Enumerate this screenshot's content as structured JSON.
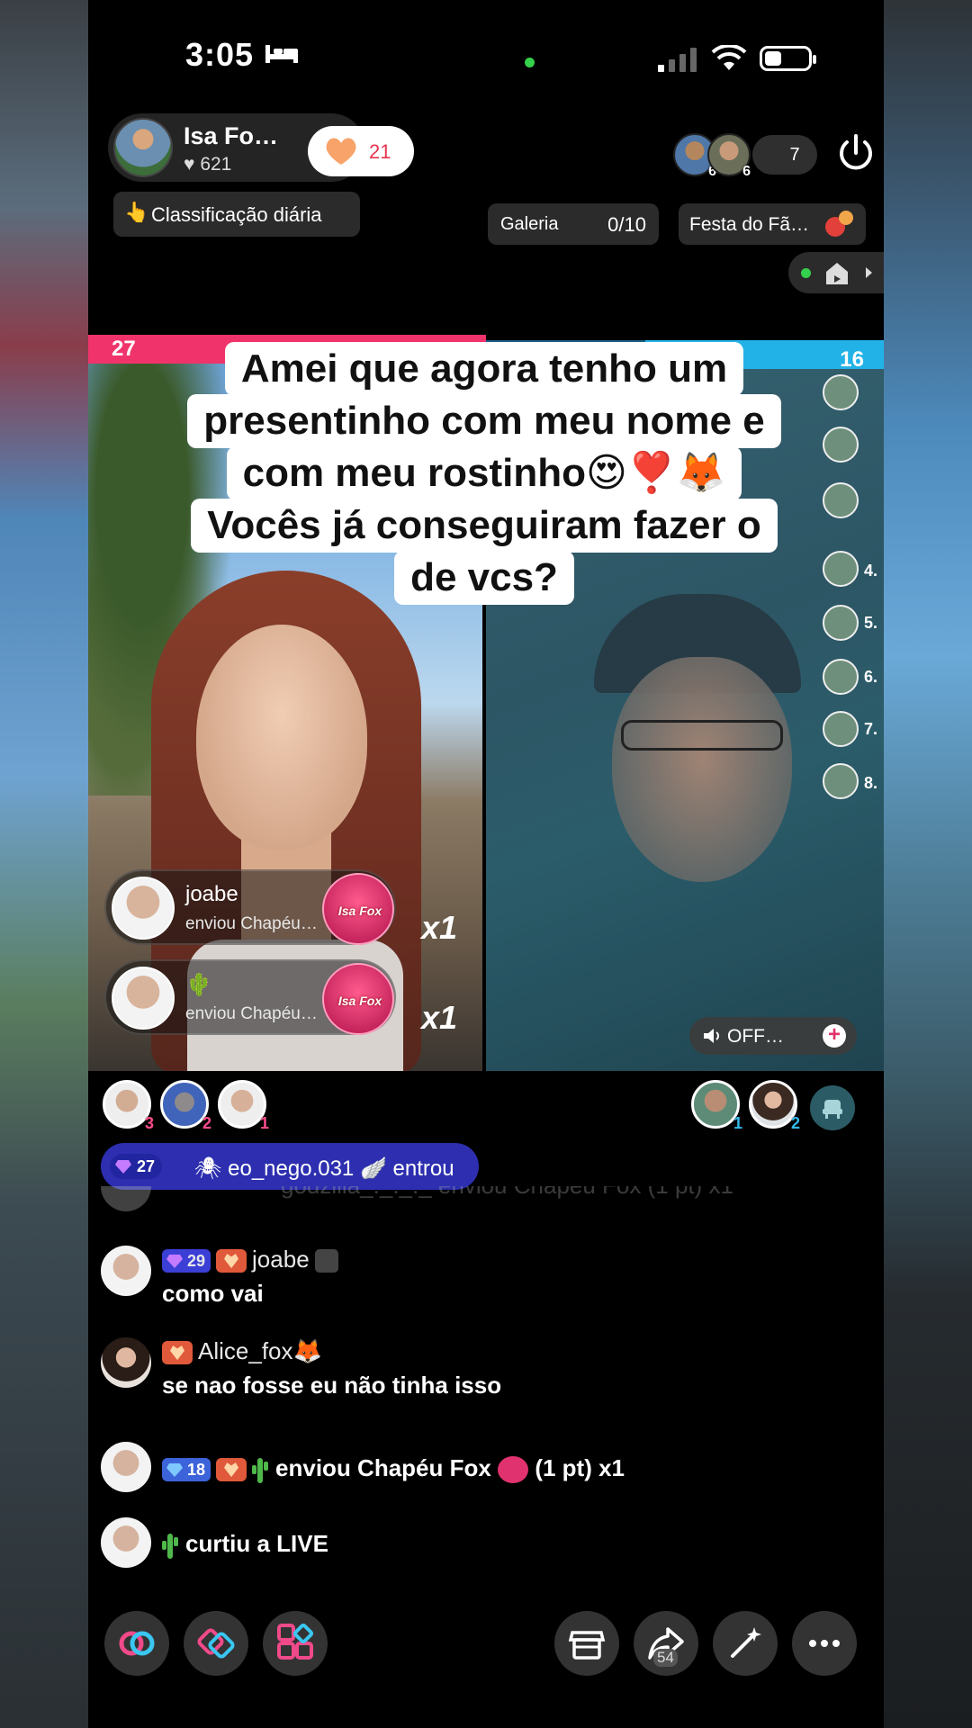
{
  "status_bar": {
    "time": "3:05"
  },
  "host": {
    "name": "Isa Fo…",
    "likes": "621",
    "like_button_count": "21"
  },
  "ranking": {
    "label": "Classificação diária"
  },
  "viewers": {
    "avatar1_badge": "6",
    "avatar2_badge": "6",
    "count": "7"
  },
  "galeria": {
    "label": "Galeria",
    "value": "0/10"
  },
  "festa": {
    "label": "Festa do Fã…"
  },
  "battle": {
    "score_left": "27",
    "score_right": "16",
    "ranks": [
      "4.",
      "5.",
      "6.",
      "7.",
      "8."
    ]
  },
  "caption": {
    "lines": [
      "Amei que agora tenho um",
      "presentinho com meu nome e",
      "com meu rostinho😍❣️🦊",
      "Vocês já conseguiram fazer o",
      "de vcs?"
    ]
  },
  "gifts": [
    {
      "name": "joabe",
      "text": "enviou Chapéu…",
      "badge": "Isa Fox",
      "multiplier": "x1"
    },
    {
      "name": "🌵",
      "text": "enviou Chapéu…",
      "badge": "Isa Fox",
      "multiplier": "x1"
    }
  ],
  "audio_pill": {
    "label": "OFF…"
  },
  "top_gifters": {
    "ranks": [
      "3",
      "2",
      "1"
    ]
  },
  "opponent_gifters": {
    "ranks": [
      "1",
      "2"
    ]
  },
  "join": {
    "level": "27",
    "text": "🕷 eo_nego.031 🪽 entrou"
  },
  "faded_line": {
    "text": "godzilla_._._._ enviou Chapéu Fox (1 pt) x1"
  },
  "chat": [
    {
      "level": "29",
      "user": "joabe",
      "message": "como vai"
    },
    {
      "user": "Alice_fox🦊",
      "message": "se nao fosse eu não tinha isso"
    },
    {
      "level": "18",
      "text": "enviou Chapéu Fox",
      "suffix": "(1 pt) x1"
    },
    {
      "text": "curtiu a LIVE"
    }
  ],
  "toolbar": {
    "share_count": "54"
  },
  "colors": {
    "battle_left": "#f0336b",
    "battle_right": "#23b2e8",
    "level_badge": "#3b3fd6"
  }
}
